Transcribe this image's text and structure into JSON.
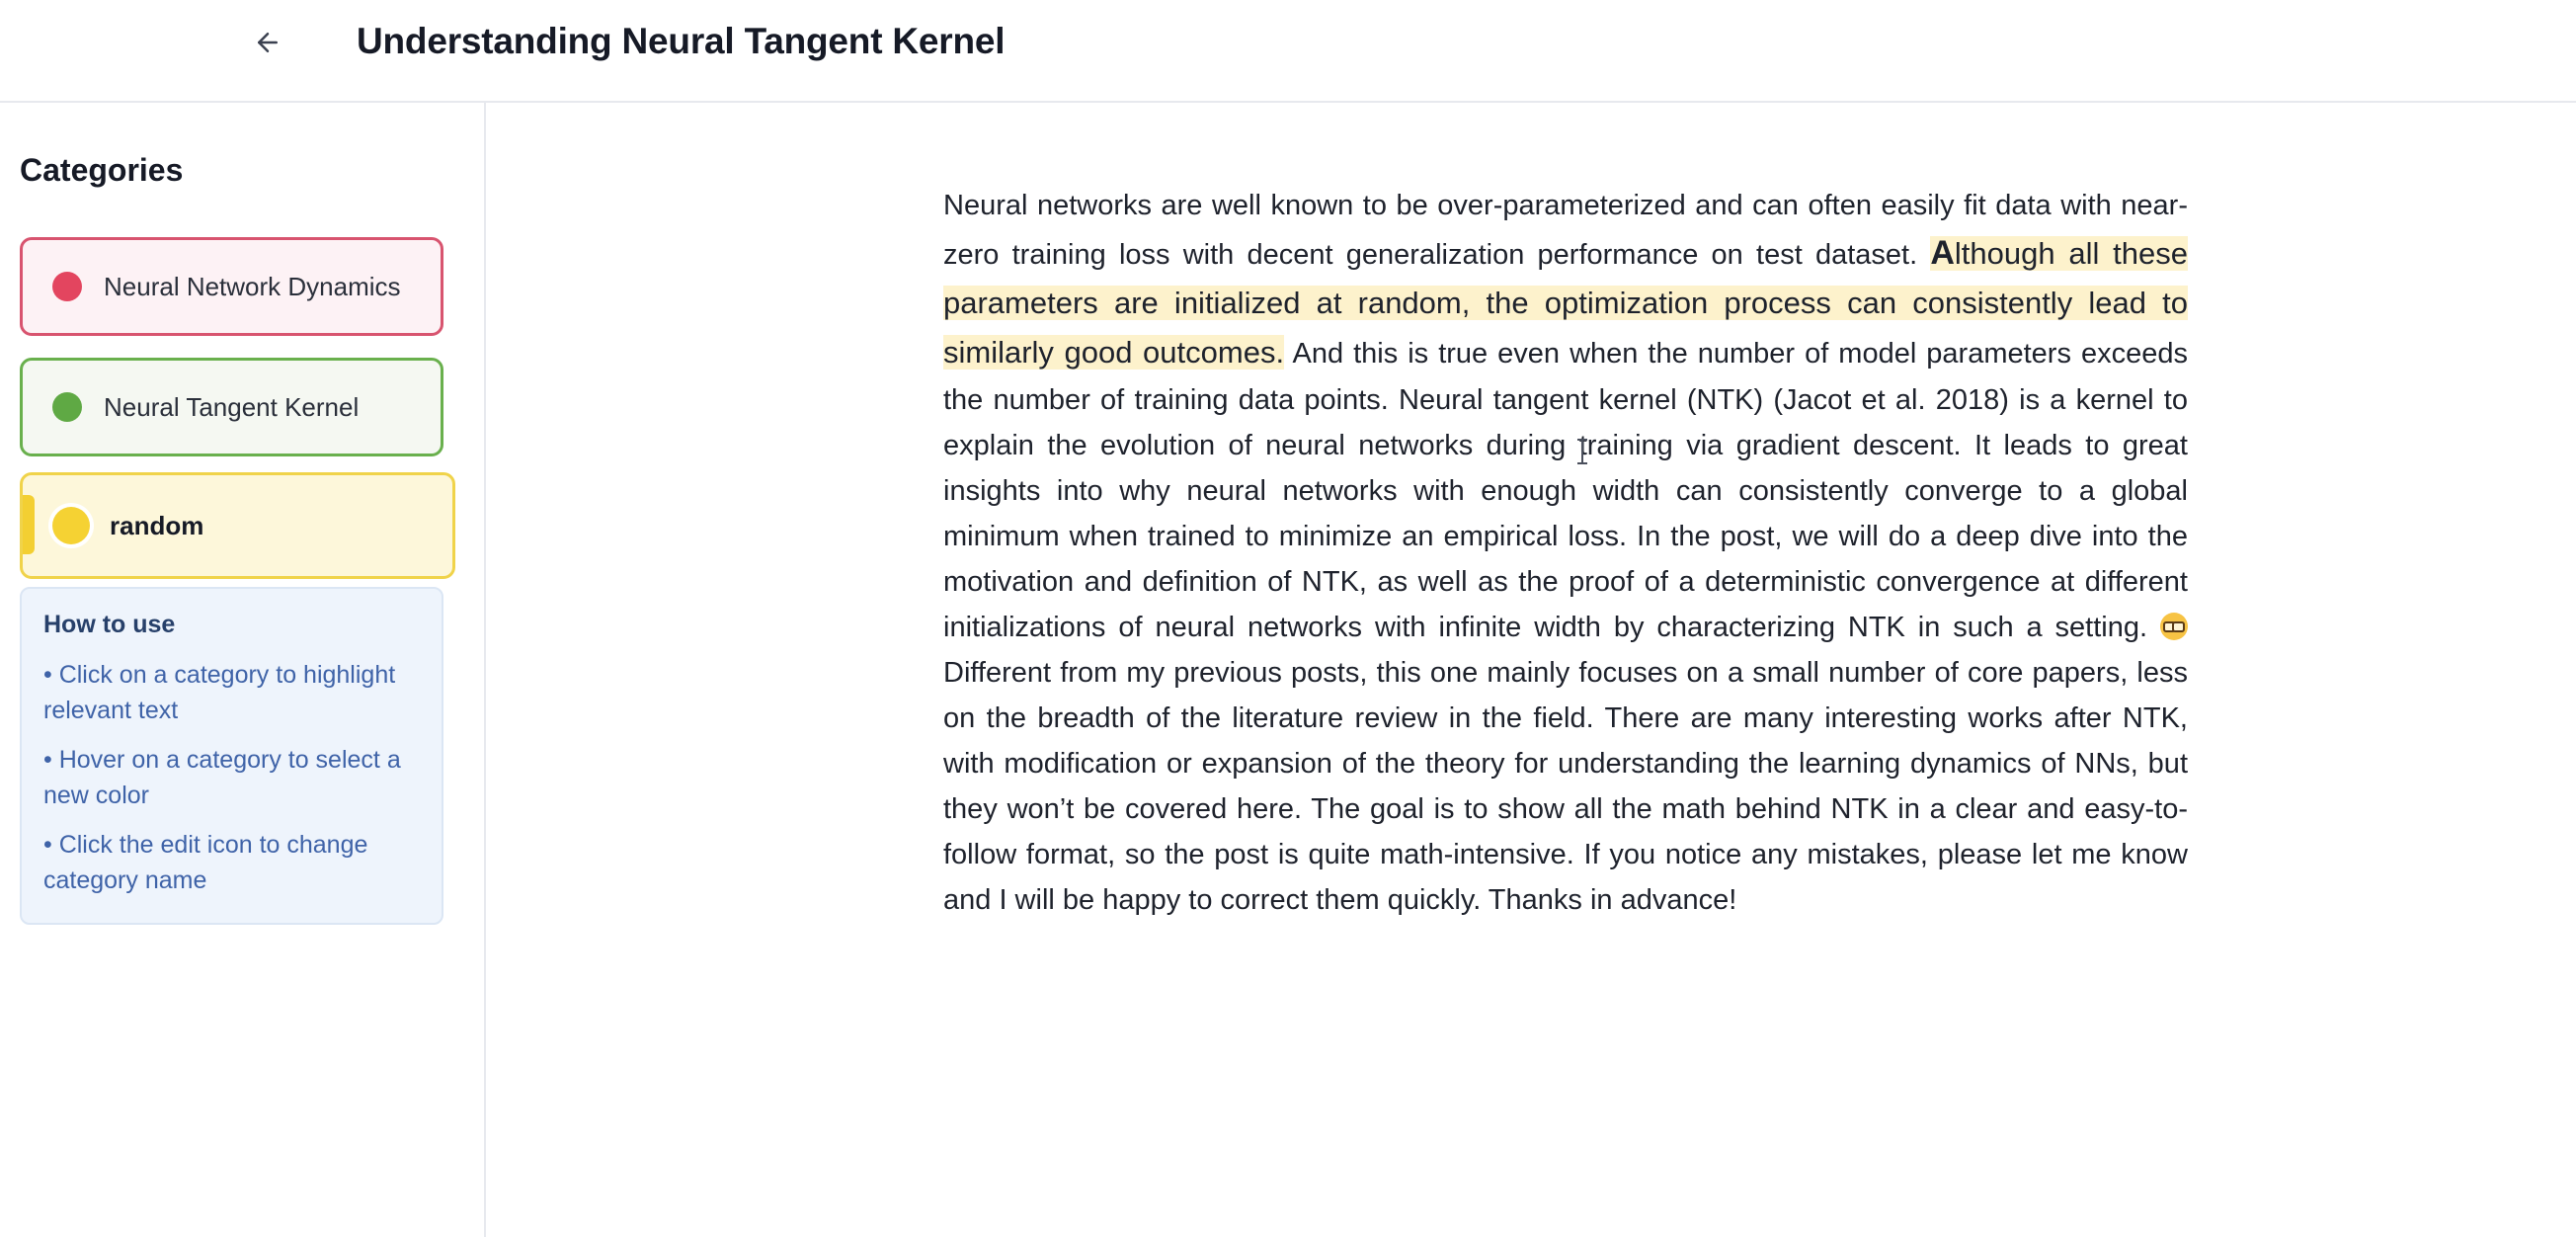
{
  "header": {
    "title": "Understanding Neural Tangent Kernel",
    "back_icon": "arrow-left-icon"
  },
  "sidebar": {
    "title": "Categories",
    "categories": [
      {
        "label": "Neural Network Dynamics",
        "color": "#e3455f",
        "border": "#d8546f",
        "selected": false
      },
      {
        "label": "Neural Tangent Kernel",
        "color": "#5fa944",
        "border": "#69b04d",
        "selected": false
      },
      {
        "label": "random",
        "color": "#f5d233",
        "border": "#f0d34a",
        "selected": true
      }
    ],
    "howto": {
      "title": "How to use",
      "items": [
        "• Click on a category to highlight relevant text",
        "• Hover on a category to select a new color",
        "• Click the edit icon to change category name"
      ]
    }
  },
  "article": {
    "p1": "Neural networks are well known to be over-parameterized and can often easily fit data with near-zero training loss with decent generalization performance on test dataset. ",
    "highlight_first": "A",
    "highlight_rest": "lthough all these parameters are initialized at random, the optimization process can consistently lead to similarly good outcomes.",
    "p2": " And this is true even when the number of model parameters exceeds the number of training data points. Neural tangent kernel (NTK) (Jacot et al. 2018) is a kernel to explain the evolution of neural networks during training via gradient descent. It leads to great insights into why neural networks with enough width can consistently converge to a global minimum when trained to minimize an empirical loss. In the post, we will do a deep dive into the motivation and definition of NTK, as well as the proof of a deterministic convergence at different initializations of neural networks with infinite width by characterizing NTK in such a setting. ",
    "emoji": "nerd-face-emoji",
    "p3": " Different from my previous posts, this one mainly focuses on a small number of core papers, less on the breadth of the literature review in the field. There are many interesting works after NTK, with modification or expansion of the theory for understanding the learning dynamics of NNs, but they won’t be covered here. The goal is to show all the math behind NTK in a clear and easy-to-follow format, so the post is quite math-intensive. If you notice any mistakes, please let me know and I will be happy to correct them quickly. Thanks in advance!",
    "highlight_color": "#fdf2cc"
  }
}
